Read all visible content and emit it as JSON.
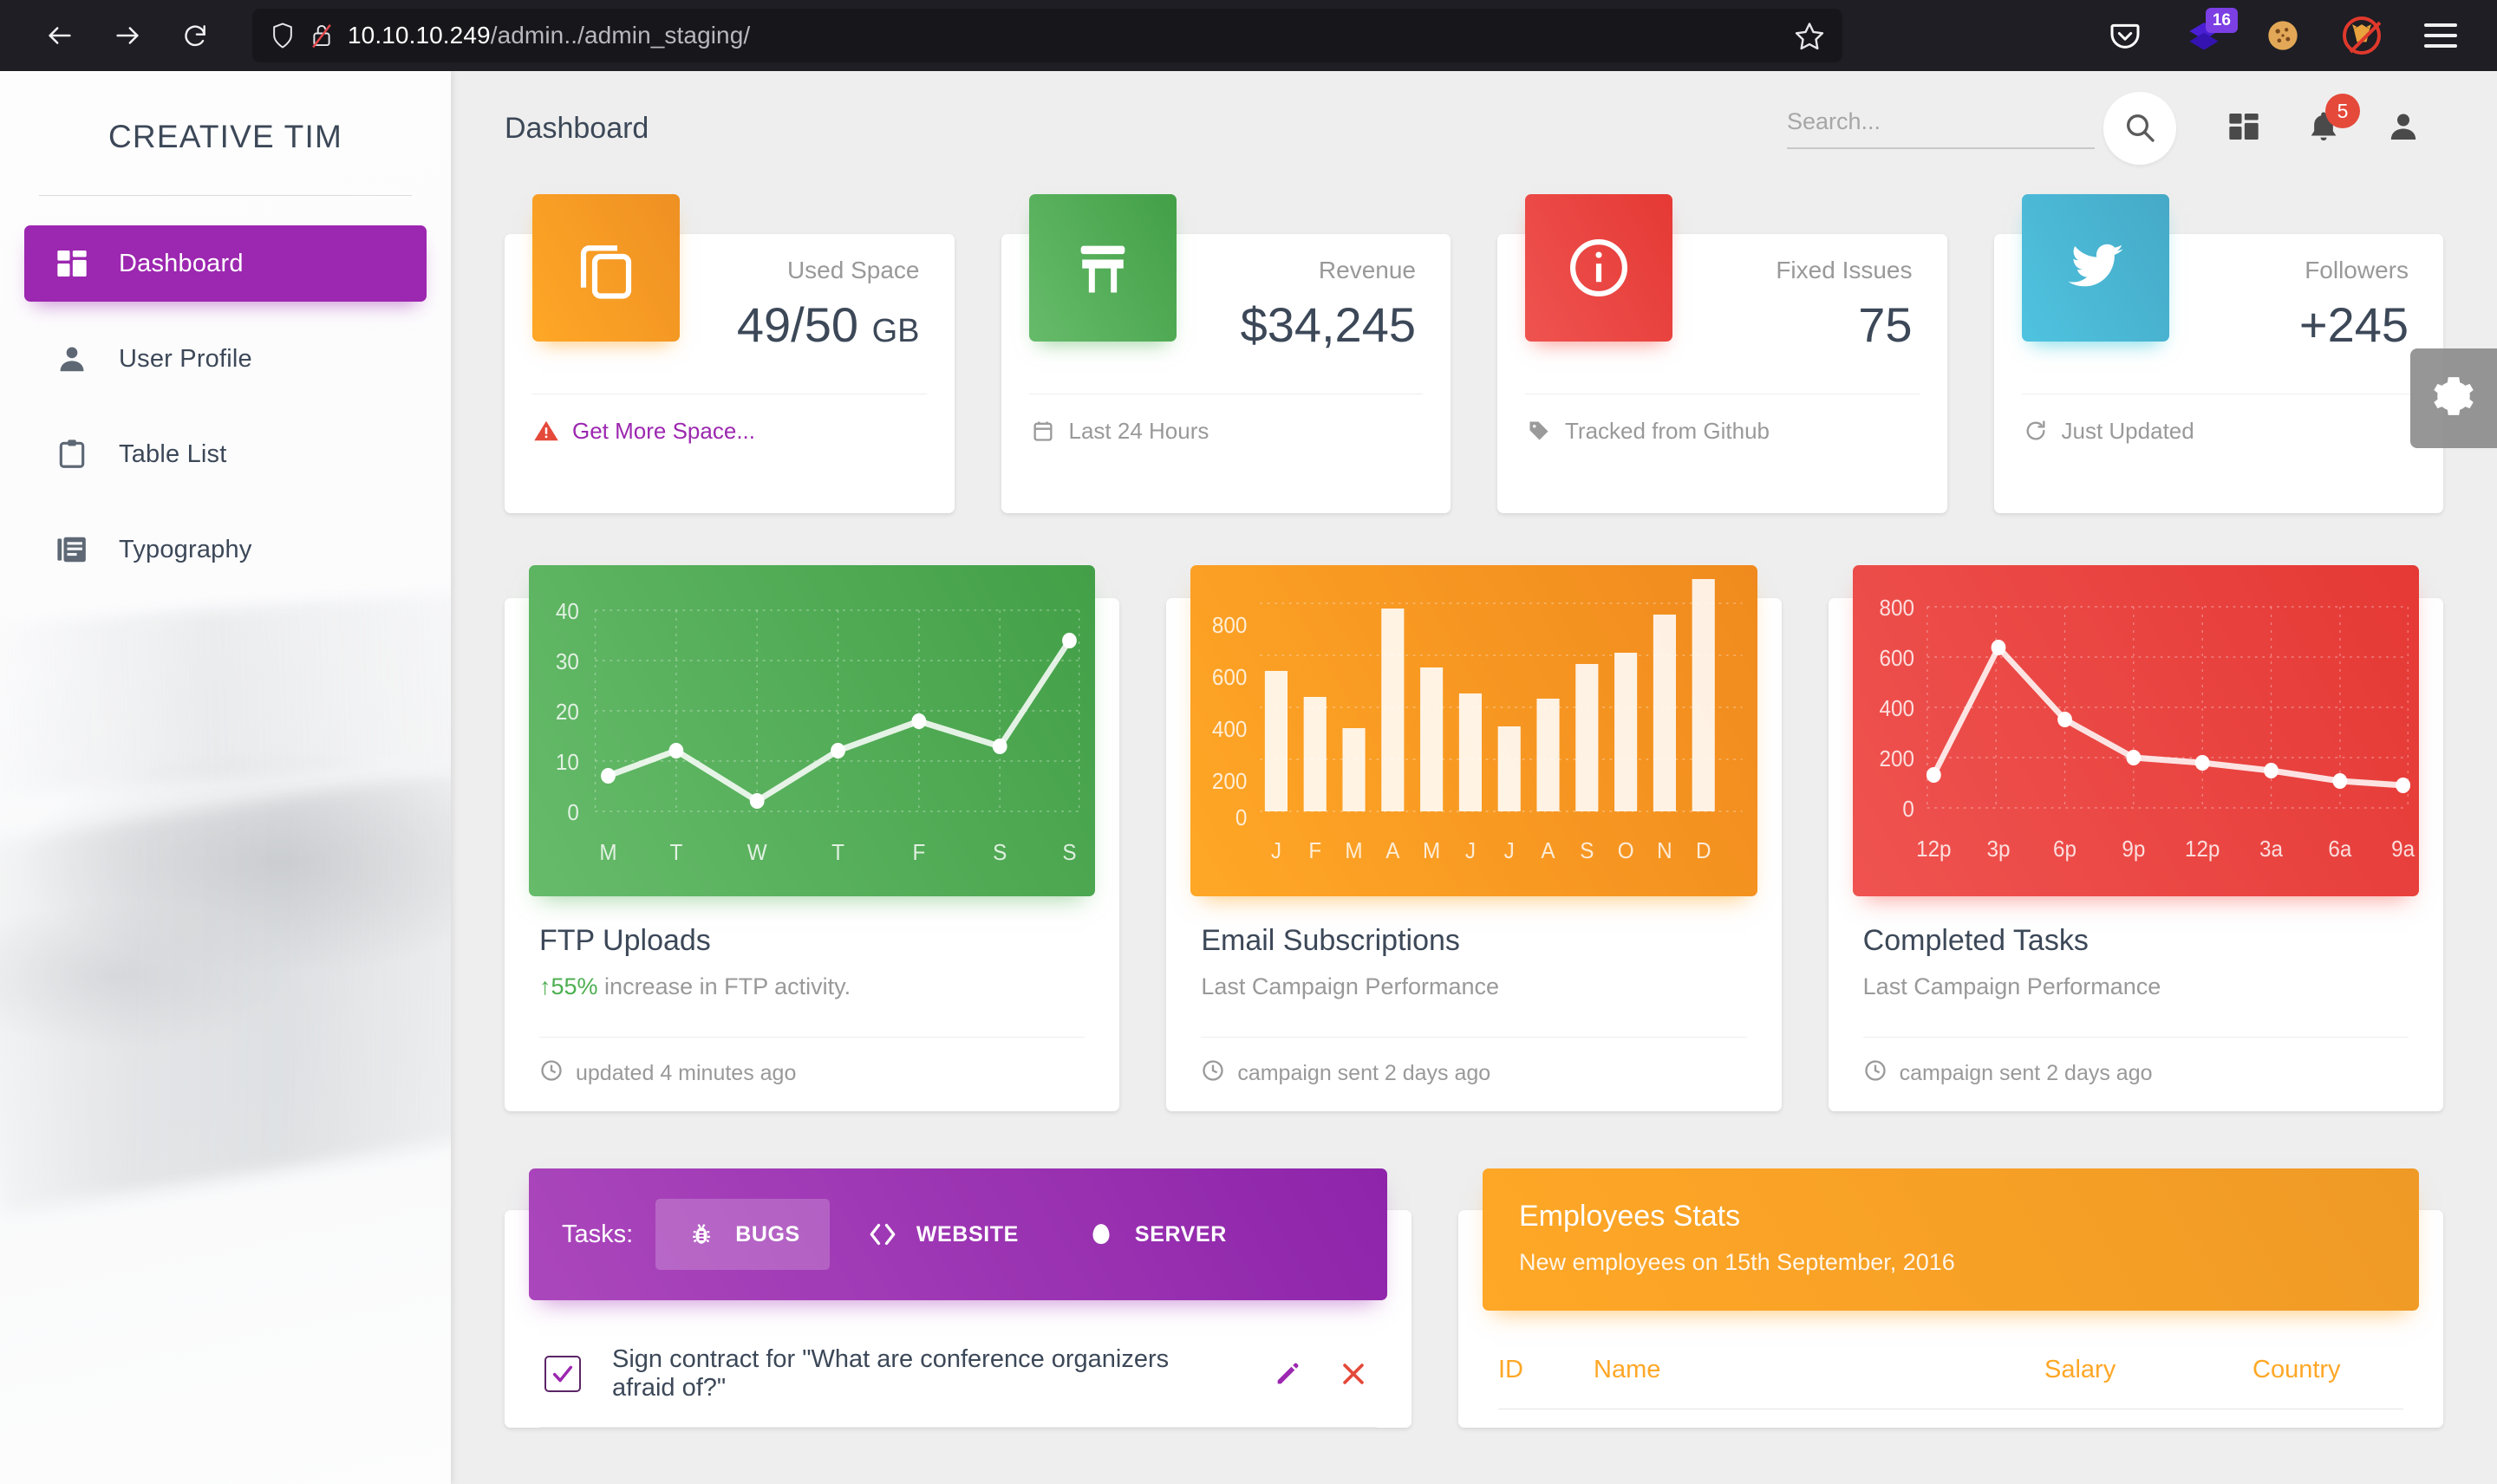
{
  "browser": {
    "back_icon": "arrow-left-icon",
    "forward_icon": "arrow-right-icon",
    "reload_icon": "reload-icon",
    "url_host": "10.10.10.249",
    "url_path": "/admin../admin_staging/",
    "bookmark_icon": "star-icon",
    "shield_icon": "shield-icon",
    "lock_broken_icon": "lock-broken-icon",
    "extensions": [
      {
        "name": "pocket-icon",
        "badge": ""
      },
      {
        "name": "layers-icon",
        "badge": "16"
      },
      {
        "name": "cookie-icon",
        "badge": ""
      },
      {
        "name": "no-fox-icon",
        "badge": ""
      }
    ],
    "menu_icon": "hamburger-menu-icon"
  },
  "sidebar": {
    "brand": "CREATIVE TIM",
    "items": [
      {
        "label": "Dashboard",
        "icon": "dashboard-grid-icon",
        "active": true
      },
      {
        "label": "User Profile",
        "icon": "person-icon",
        "active": false
      },
      {
        "label": "Table List",
        "icon": "clipboard-icon",
        "active": false
      },
      {
        "label": "Typography",
        "icon": "library-books-icon",
        "active": false
      }
    ]
  },
  "navbar": {
    "title": "Dashboard",
    "search_placeholder": "Search...",
    "search_value": "",
    "search_icon": "search-icon",
    "apps_icon": "dashboard-grid-icon",
    "bell_icon": "notifications-bell-icon",
    "bell_badge": "5",
    "person_icon": "person-icon",
    "settings_gear_icon": "gear-icon"
  },
  "stats": [
    {
      "icon": "content-copy-icon",
      "color": "#f0a03c",
      "label": "Used Space",
      "value": "49/50",
      "unit": "GB",
      "foot_icon": "warning-icon",
      "foot_text": "Get More Space...",
      "foot_link": true
    },
    {
      "icon": "store-icon",
      "color": "#4caf50",
      "label": "Revenue",
      "value": "$34,245",
      "unit": "",
      "foot_icon": "calendar-icon",
      "foot_text": "Last 24 Hours",
      "foot_link": false
    },
    {
      "icon": "info-icon",
      "color": "#e4493a",
      "label": "Fixed Issues",
      "value": "75",
      "unit": "",
      "foot_icon": "tag-icon",
      "foot_text": "Tracked from Github",
      "foot_link": false
    },
    {
      "icon": "twitter-icon",
      "color": "#4eb3cd",
      "label": "Followers",
      "value": "+245",
      "unit": "",
      "foot_icon": "update-icon",
      "foot_text": "Just Updated",
      "foot_link": false
    }
  ],
  "charts": [
    {
      "title": "FTP Uploads",
      "subtitle_prefix": "55%",
      "subtitle": " increase in FTP activity.",
      "subtitle_arrow": "arrow-up-icon",
      "foot_icon": "clock-icon",
      "foot_text": "updated 4 minutes ago",
      "theme": "green"
    },
    {
      "title": "Email Subscriptions",
      "subtitle_prefix": "",
      "subtitle": "Last Campaign Performance",
      "subtitle_arrow": "",
      "foot_icon": "clock-icon",
      "foot_text": "campaign sent 2 days ago",
      "theme": "orange"
    },
    {
      "title": "Completed Tasks",
      "subtitle_prefix": "",
      "subtitle": "Last Campaign Performance",
      "subtitle_arrow": "",
      "foot_icon": "clock-icon",
      "foot_text": "campaign sent 2 days ago",
      "theme": "red"
    }
  ],
  "chart_data": [
    {
      "type": "line",
      "title": "FTP Uploads",
      "categories": [
        "M",
        "T",
        "W",
        "T",
        "F",
        "S",
        "S"
      ],
      "values": [
        7,
        12,
        2,
        12,
        18,
        13,
        34
      ],
      "yticks": [
        0,
        10,
        20,
        30,
        40
      ],
      "ylim": [
        0,
        45
      ],
      "xlabel": "",
      "ylabel": "",
      "grid": true,
      "legend": "none",
      "series_color": "#ffffff",
      "bg_color": "#4caf50"
    },
    {
      "type": "bar",
      "title": "Email Subscriptions",
      "categories": [
        "J",
        "F",
        "M",
        "A",
        "M",
        "J",
        "J",
        "A",
        "S",
        "O",
        "N",
        "D"
      ],
      "values": [
        542,
        443,
        320,
        780,
        553,
        453,
        326,
        434,
        568,
        610,
        756,
        895
      ],
      "yticks": [
        0,
        200,
        400,
        600,
        800
      ],
      "ylim": [
        0,
        950
      ],
      "xlabel": "",
      "ylabel": "",
      "grid": true,
      "legend": "none",
      "series_color": "#fdf3e3",
      "bg_color": "#ffa726"
    },
    {
      "type": "line",
      "title": "Completed Tasks",
      "categories": [
        "12p",
        "3p",
        "6p",
        "9p",
        "12p",
        "3a",
        "6a",
        "9a"
      ],
      "values": [
        130,
        640,
        350,
        200,
        180,
        150,
        110,
        90
      ],
      "yticks": [
        0,
        200,
        400,
        600,
        800
      ],
      "ylim": [
        0,
        900
      ],
      "xlabel": "",
      "ylabel": "",
      "grid": true,
      "legend": "none",
      "series_color": "#ffffff",
      "bg_color": "#ef5350"
    }
  ],
  "tasks": {
    "label": "Tasks:",
    "tabs": [
      {
        "label": "BUGS",
        "icon": "bug-icon",
        "active": true
      },
      {
        "label": "WEBSITE",
        "icon": "code-icon",
        "active": false
      },
      {
        "label": "SERVER",
        "icon": "cloud-icon",
        "active": false
      }
    ],
    "items": [
      {
        "text": "Sign contract for \"What are conference organizers afraid of?\"",
        "checked": true,
        "edit_icon": "pencil-icon",
        "delete_icon": "close-x-icon"
      }
    ]
  },
  "employees": {
    "title": "Employees Stats",
    "subtitle": "New employees on 15th September, 2016",
    "columns": [
      "ID",
      "Name",
      "Salary",
      "Country"
    ],
    "rows": []
  }
}
